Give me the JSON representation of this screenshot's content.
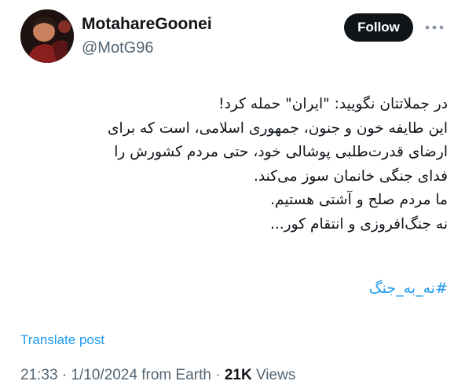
{
  "author": {
    "display_name": "MotahareGoonei",
    "handle": "@MotG96"
  },
  "follow_button": {
    "label": "Follow"
  },
  "more_button": {
    "icon": "more-dots-icon"
  },
  "tweet": {
    "lines": [
      "در جملاتتان نگویید: \"ایران\" حمله کرد!",
      "این طایفه خون و جنون، جمهوری اسلامی، است که برای",
      "ارضای قدرت‌طلبی پوشالی خود، حتی مردم کشورش را",
      "فدای جنگی خانمان سوز می‌کند.",
      "ما مردم صلح و آشتی هستیم.",
      "نه جنگ‌افروزی و انتقام کور..."
    ],
    "hashtag": "#نه_به_جنگ"
  },
  "translate_label": "Translate post",
  "meta": {
    "time": "21:33",
    "separator1": " · ",
    "date": "1/10/2024",
    "source": " from Earth",
    "separator2": " · ",
    "views_count": "21K",
    "views_label": " Views"
  },
  "colors": {
    "text": "#0f1419",
    "secondary": "#536471",
    "link": "#1d9bf0",
    "button_bg": "#0f1419",
    "button_text": "#ffffff"
  }
}
